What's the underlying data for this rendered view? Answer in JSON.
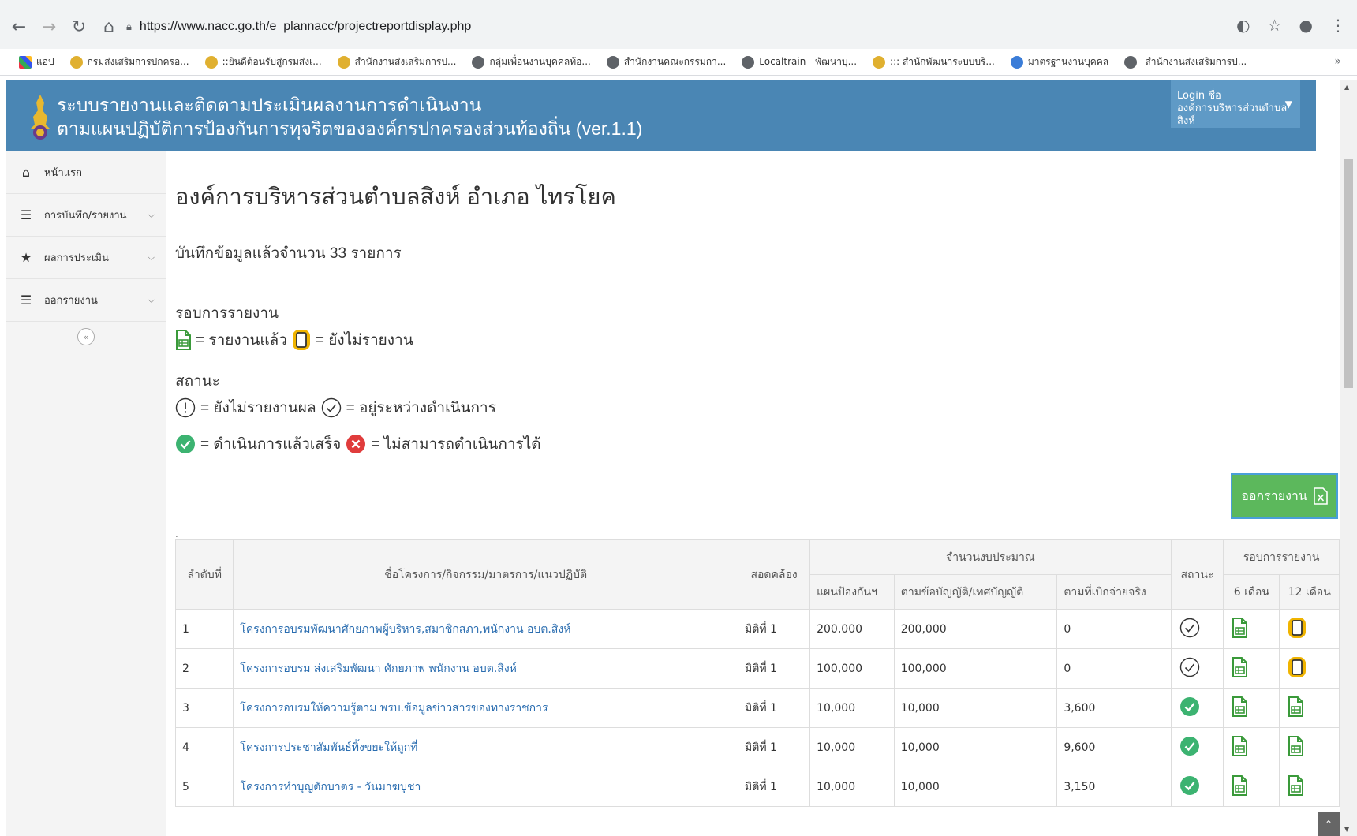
{
  "browser": {
    "url": "https://www.nacc.go.th/e_plannacc/projectreportdisplay.php",
    "bookmarks": [
      "แอป",
      "กรมส่งเสริมการปกครอ...",
      "::ยินดีต้อนรับสู่กรมส่งเ...",
      "สำนักงานส่งเสริมการป...",
      "กลุ่มเพื่อนงานบุคคลท้อ...",
      "สำนักงานคณะกรรมกา...",
      "Localtrain - พัฒนาบุ...",
      "::: สำนักพัฒนาระบบบริ...",
      "มาตรฐานงานบุคคล",
      "-สำนักงานส่งเสริมการป..."
    ],
    "more": "»"
  },
  "header": {
    "title_line1": "ระบบรายงานและติดตามประเมินผลงานการดำเนินงาน",
    "title_line2": "ตามแผนปฏิบัติการป้องกันการทุจริตขององค์กรปกครองส่วนท้องถิ่น (ver.1.1)",
    "login_label": "Login ชื่อ",
    "login_user": "องค์การบริหารส่วนตำบลสิงห์"
  },
  "sidebar": {
    "items": [
      {
        "label": "หน้าแรก",
        "icon": "home-icon"
      },
      {
        "label": "การบันทึก/รายงาน",
        "icon": "list-icon"
      },
      {
        "label": "ผลการประเมิน",
        "icon": "star-icon"
      },
      {
        "label": "ออกรายงาน",
        "icon": "list-icon"
      }
    ],
    "collapse": "«"
  },
  "main": {
    "title": "องค์การบริหารส่วนตำบลสิงห์ อำเภอ ไทรโยค",
    "count_text": "บันทึกข้อมูลแล้วจำนวน 33 รายการ",
    "legend_round_heading": "รอบการรายงาน",
    "legend_reported": "= รายงานแล้ว",
    "legend_not_reported": "= ยังไม่รายงาน",
    "legend_status_heading": "สถานะ",
    "legend_no_result": "= ยังไม่รายงานผล",
    "legend_in_progress": "= อยู่ระหว่างดำเนินการ",
    "legend_done": "= ดำเนินการแล้วเสร็จ",
    "legend_unable": "= ไม่สามารถดำเนินการได้",
    "export_label": "ออกรายงาน",
    "dot": "."
  },
  "table": {
    "headers": {
      "no": "ลำดับที่",
      "name": "ชื่อโครงการ/กิจกรรม/มาตรการ/แนวปฏิบัติ",
      "dimension": "สอดคล้อง",
      "budget": "จำนวนงบประมาณ",
      "plan": "แผนป้องกันฯ",
      "by_law": "ตามข้อบัญญัติ/เทศบัญญัติ",
      "actual": "ตามที่เบิกจ่ายจริง",
      "status": "สถานะ",
      "round": "รอบการรายงาน",
      "m6": "6 เดือน",
      "m12": "12 เดือน"
    },
    "rows": [
      {
        "no": "1",
        "name": "โครงการอบรมพัฒนาศักยภาพผู้บริหาร,สมาชิกสภา,พนักงาน อบต.สิงห์",
        "dim": "มิติที่ 1",
        "plan": "200,000",
        "law": "200,000",
        "actual": "0",
        "status": "in-progress",
        "m6": "reported",
        "m12": "pending"
      },
      {
        "no": "2",
        "name": "โครงการอบรม ส่งเสริมพัฒนา ศักยภาพ พนักงาน อบต.สิงห์",
        "dim": "มิติที่ 1",
        "plan": "100,000",
        "law": "100,000",
        "actual": "0",
        "status": "in-progress",
        "m6": "reported",
        "m12": "pending"
      },
      {
        "no": "3",
        "name": "โครงการอบรมให้ความรู้ตาม พรบ.ข้อมูลข่าวสารของทางราชการ",
        "dim": "มิติที่ 1",
        "plan": "10,000",
        "law": "10,000",
        "actual": "3,600",
        "status": "done",
        "m6": "reported",
        "m12": "reported"
      },
      {
        "no": "4",
        "name": "โครงการประชาสัมพันธ์ทิ้งขยะให้ถูกที่",
        "dim": "มิติที่ 1",
        "plan": "10,000",
        "law": "10,000",
        "actual": "9,600",
        "status": "done",
        "m6": "reported",
        "m12": "reported"
      },
      {
        "no": "5",
        "name": "โครงการทำบุญตักบาตร - วันมาฆบูชา",
        "dim": "มิติที่ 1",
        "plan": "10,000",
        "law": "10,000",
        "actual": "3,150",
        "status": "done",
        "m6": "reported",
        "m12": "reported"
      }
    ]
  },
  "colors": {
    "header_bg": "#4a86b4",
    "done_green": "#3cb371",
    "unable_red": "#e03c3c",
    "pending_yellow": "#f0b400",
    "doc_green": "#3a9a3a",
    "link_blue": "#2a6db0",
    "export_green": "#5cb85c"
  }
}
